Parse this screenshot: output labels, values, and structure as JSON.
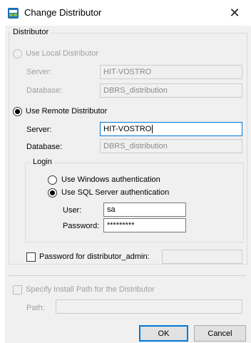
{
  "window": {
    "title": "Change Distributor",
    "close_glyph": "✕"
  },
  "distributor_group": {
    "legend": "Distributor"
  },
  "local": {
    "radio_label": "Use Local Distributor",
    "server_label": "Server:",
    "server_value": "HIT-VOSTRO",
    "database_label": "Database:",
    "database_value": "DBRS_distribution"
  },
  "remote": {
    "radio_label": "Use Remote Distributor",
    "server_label": "Server:",
    "server_value": "HIT-VOSTRO",
    "database_label": "Database:",
    "database_value": "DBRS_distribution"
  },
  "login": {
    "legend": "Login",
    "windows_auth_label": "Use Windows authentication",
    "sql_auth_label": "Use SQL Server authentication",
    "user_label": "User:",
    "user_value": "sa",
    "password_label": "Password:",
    "password_value": "*********"
  },
  "admin_password": {
    "label": "Password for distributor_admin:",
    "value": ""
  },
  "install_path": {
    "label": "Specify Install Path for the Distributor",
    "path_label": "Path:",
    "path_value": ""
  },
  "buttons": {
    "ok": "OK",
    "cancel": "Cancel"
  }
}
